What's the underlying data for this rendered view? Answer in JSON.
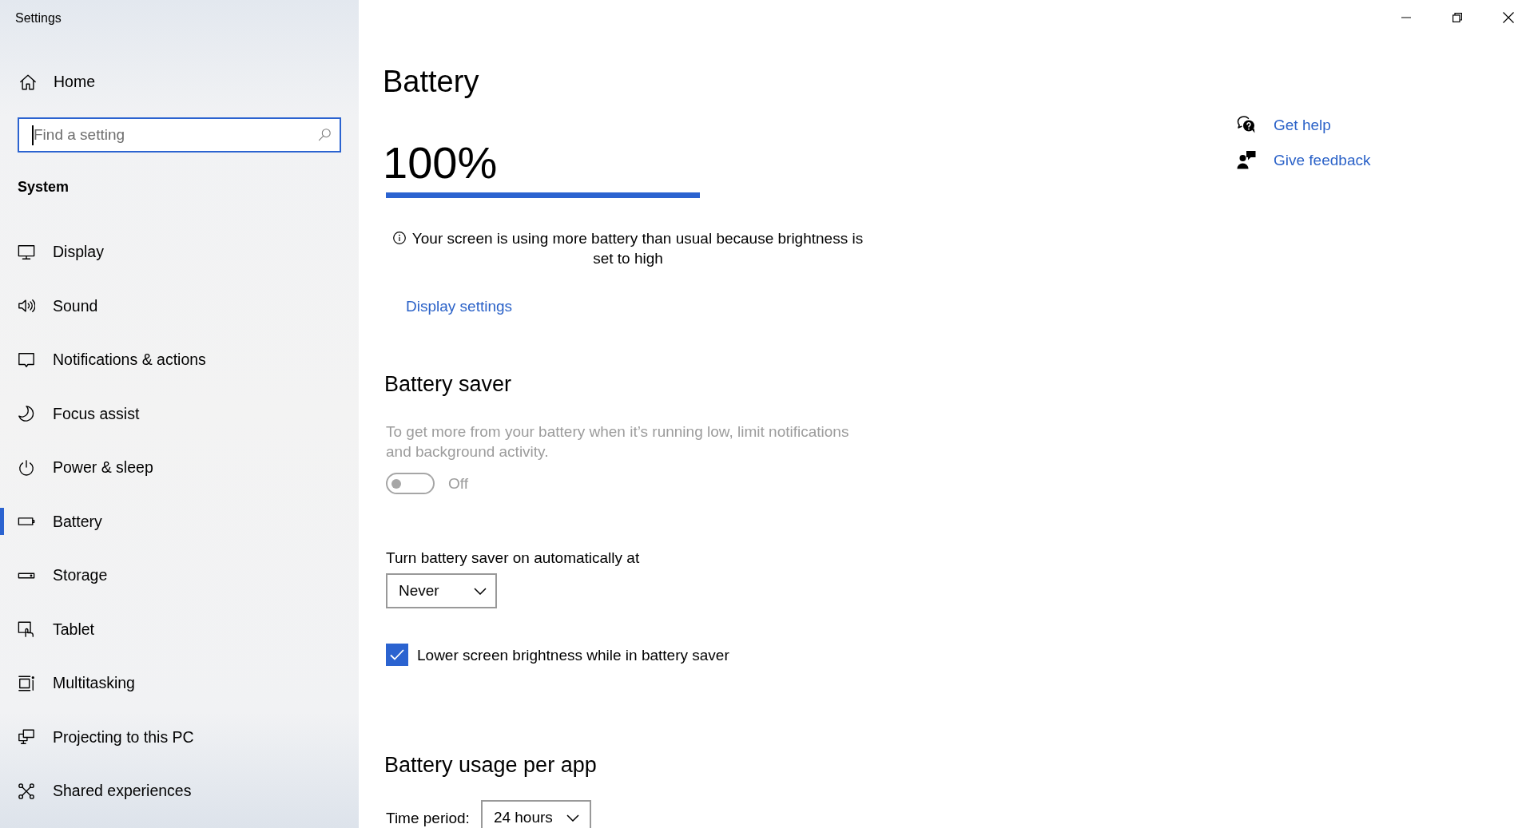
{
  "window": {
    "title": "Settings"
  },
  "sidebar": {
    "home": {
      "label": "Home"
    },
    "search": {
      "placeholder": "Find a setting",
      "focused": true
    },
    "section_title": "System",
    "items": [
      {
        "label": "Display",
        "selected": false
      },
      {
        "label": "Sound",
        "selected": false
      },
      {
        "label": "Notifications & actions",
        "selected": false
      },
      {
        "label": "Focus assist",
        "selected": false
      },
      {
        "label": "Power & sleep",
        "selected": false
      },
      {
        "label": "Battery",
        "selected": true
      },
      {
        "label": "Storage",
        "selected": false
      },
      {
        "label": "Tablet",
        "selected": false
      },
      {
        "label": "Multitasking",
        "selected": false
      },
      {
        "label": "Projecting to this PC",
        "selected": false
      },
      {
        "label": "Shared experiences",
        "selected": false
      }
    ]
  },
  "page": {
    "title": "Battery",
    "charge": {
      "reading": "100%",
      "level": 1
    },
    "notice": "Your screen is using more battery than usual because brightness is set to high",
    "display_settings_link": "Display settings",
    "battery_saver": {
      "heading": "Battery saver",
      "description": "To get more from your battery when it’s running low, limit notifications and background activity.",
      "toggle": {
        "on": false,
        "disabled": true,
        "label": "Off"
      },
      "auto_on": {
        "label": "Turn battery saver on automatically at",
        "value": "Never"
      },
      "lower_brightness": {
        "label": "Lower screen brightness while in battery saver",
        "checked": true
      }
    },
    "usage_per_app": {
      "heading": "Battery usage per app",
      "time_period": {
        "label": "Time period:",
        "value": "24 hours"
      }
    }
  },
  "related_links": [
    {
      "label": "Get help"
    },
    {
      "label": "Give feedback"
    }
  ]
}
